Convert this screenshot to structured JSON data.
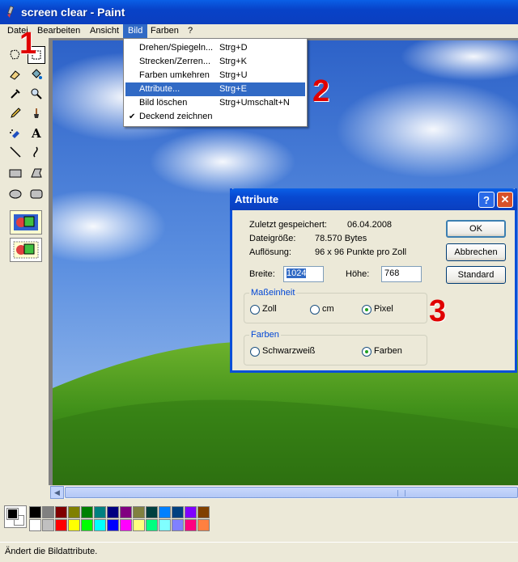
{
  "window": {
    "title": "screen clear - Paint"
  },
  "menubar": {
    "items": [
      "Datei",
      "Bearbeiten",
      "Ansicht",
      "Bild",
      "Farben",
      "?"
    ],
    "active": "Bild"
  },
  "bild_menu": {
    "items": [
      {
        "label": "Drehen/Spiegeln...",
        "shortcut": "Strg+D"
      },
      {
        "label": "Strecken/Zerren...",
        "shortcut": "Strg+K"
      },
      {
        "label": "Farben umkehren",
        "shortcut": "Strg+U"
      },
      {
        "label": "Attribute...",
        "shortcut": "Strg+E",
        "highlighted": true
      },
      {
        "label": "Bild löschen",
        "shortcut": "Strg+Umschalt+N"
      },
      {
        "label": "Deckend zeichnen",
        "shortcut": "",
        "checked": true
      }
    ]
  },
  "dialog": {
    "title": "Attribute",
    "help_label": "?",
    "close_label": "✕",
    "saved_label": "Zuletzt gespeichert:",
    "saved_value": "06.04.2008",
    "size_label": "Dateigröße:",
    "size_value": "78.570 Bytes",
    "resolution_label": "Auflösung:",
    "resolution_value": "96 x 96 Punkte pro Zoll",
    "width_label": "Breite:",
    "width_value": "1024",
    "height_label": "Höhe:",
    "height_value": "768",
    "units_group": "Maßeinheit",
    "units": [
      {
        "label": "Zoll",
        "selected": false
      },
      {
        "label": "cm",
        "selected": false
      },
      {
        "label": "Pixel",
        "selected": true
      }
    ],
    "colors_group": "Farben",
    "colors": [
      {
        "label": "Schwarzweiß",
        "selected": false
      },
      {
        "label": "Farben",
        "selected": true
      }
    ],
    "ok_label": "OK",
    "cancel_label": "Abbrechen",
    "default_label": "Standard"
  },
  "annotations": [
    "1",
    "2",
    "3"
  ],
  "palette": {
    "row1": [
      "#000000",
      "#808080",
      "#800000",
      "#808000",
      "#008000",
      "#008080",
      "#000080",
      "#800080",
      "#808040",
      "#004040",
      "#0080ff",
      "#004080",
      "#8000ff",
      "#804000"
    ],
    "row2": [
      "#ffffff",
      "#c0c0c0",
      "#ff0000",
      "#ffff00",
      "#00ff00",
      "#00ffff",
      "#0000ff",
      "#ff00ff",
      "#ffff80",
      "#00ff80",
      "#80ffff",
      "#8080ff",
      "#ff0080",
      "#ff8040"
    ]
  },
  "status": {
    "text": "Ändert die Bildattribute."
  }
}
